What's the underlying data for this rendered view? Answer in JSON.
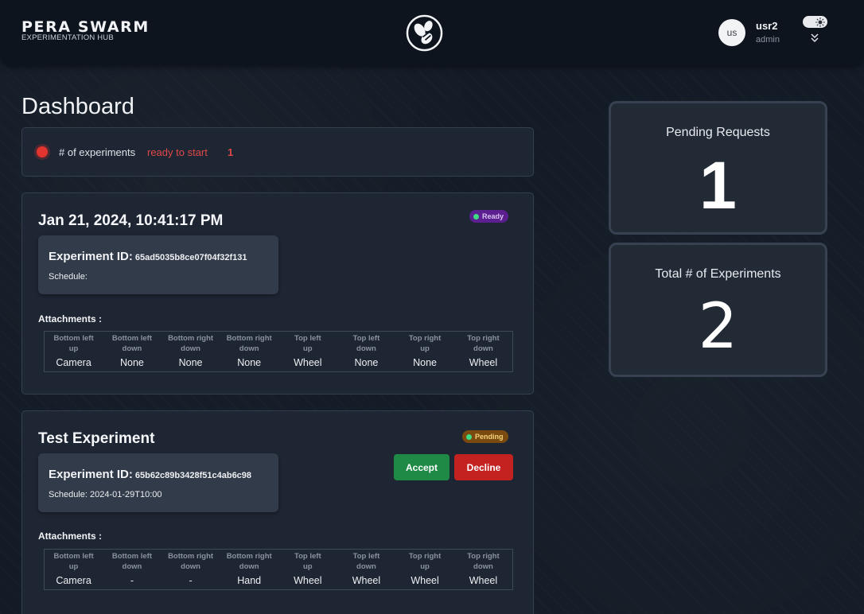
{
  "header": {
    "logo_title": "PERA SWARM",
    "logo_subtitle": "EXPERIMENTATION HUB",
    "brand_icon": "bee-icon",
    "avatar_initials": "us",
    "user_name": "usr2",
    "user_role": "admin",
    "theme_toggle_icon": "sun-icon",
    "expand_icon": "double-chevron-down-icon"
  },
  "page": {
    "title": "Dashboard"
  },
  "summary": {
    "label": "# of experiments",
    "status": "ready to start",
    "count": "1",
    "indicator_color": "#e3342f"
  },
  "attachment_headers": [
    [
      "Bottom left",
      "up"
    ],
    [
      "Bottom left",
      "down"
    ],
    [
      "Bottom right",
      "down"
    ],
    [
      "Bottom right",
      "down"
    ],
    [
      "Top left",
      "up"
    ],
    [
      "Top left",
      "down"
    ],
    [
      "Top right",
      "up"
    ],
    [
      "Top right",
      "down"
    ]
  ],
  "experiments": [
    {
      "title": "Jan 21, 2024, 10:41:17 PM",
      "badge": "Ready",
      "id_label": "Experiment ID:",
      "id_value": "65ad5035b8ce07f04f32f131",
      "schedule": "Schedule:",
      "attachments_label": "Attachments :",
      "attachments": [
        "Camera",
        "None",
        "None",
        "None",
        "Wheel",
        "None",
        "None",
        "Wheel"
      ]
    },
    {
      "title": "Test Experiment",
      "badge": "Pending",
      "id_label": "Experiment ID:",
      "id_value": "65b62c89b3428f51c4ab6c98",
      "schedule": "Schedule: 2024-01-29T10:00",
      "attachments_label": "Attachments :",
      "attachments": [
        "Camera",
        "-",
        "-",
        "Hand",
        "Wheel",
        "Wheel",
        "Wheel",
        "Wheel"
      ],
      "accept_label": "Accept",
      "decline_label": "Decline"
    }
  ],
  "stats": {
    "pending_label": "Pending Requests",
    "pending_value": "1",
    "total_label": "Total # of Experiments",
    "total_value": "2"
  },
  "colors": {
    "accept": "#1f8a45",
    "decline": "#c42121",
    "ready_badge": "#5b1f8f",
    "pending_badge": "#7a4a10",
    "badge_dot": "#3ddc84"
  }
}
